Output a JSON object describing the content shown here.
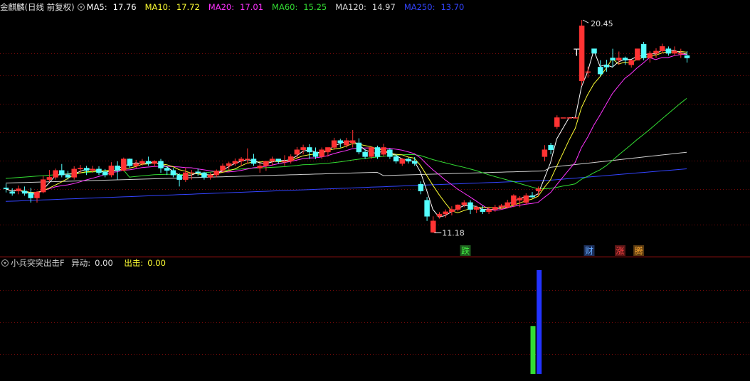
{
  "main_header": {
    "title": "金麒麟(日线 前复权)",
    "ma": [
      {
        "label": "MA5:",
        "value": "17.76",
        "color": "#ffffff"
      },
      {
        "label": "MA10:",
        "value": "17.72",
        "color": "#ffff33"
      },
      {
        "label": "MA20:",
        "value": "17.01",
        "color": "#ff33ff"
      },
      {
        "label": "MA60:",
        "value": "15.25",
        "color": "#33dd33"
      },
      {
        "label": "MA120:",
        "value": "14.97",
        "color": "#d8d8d8"
      },
      {
        "label": "MA250:",
        "value": "13.70",
        "color": "#3344ff"
      }
    ]
  },
  "indicator_header": {
    "name": "小兵突突出击F",
    "fields": [
      {
        "label": "异动:",
        "value": "0.00",
        "color": "#e0e0e0"
      },
      {
        "label": "出击:",
        "value": "0.00",
        "color": "#ffff33"
      }
    ]
  },
  "annotations": {
    "high": "20.45",
    "low": "11.18",
    "t_mark": "T",
    "badges": [
      {
        "text": "跌",
        "bg": "#1d5a1d",
        "fg": "#44ee44"
      },
      {
        "text": "财",
        "bg": "#1c2f5a",
        "fg": "#66aaff"
      },
      {
        "text": "涨",
        "bg": "#5a1616",
        "fg": "#ff4444"
      },
      {
        "text": "腾",
        "bg": "#5a3a10",
        "fg": "#ffaa33"
      }
    ]
  },
  "chart_data": {
    "type": "candlestick",
    "price_range": [
      10.3,
      21.2
    ],
    "up_color": "#ff3333",
    "down_color": "#54ffff",
    "candles": [
      [
        13.14,
        13.32,
        12.94,
        13.1
      ],
      [
        12.97,
        13.12,
        12.8,
        12.9
      ],
      [
        13.0,
        13.24,
        12.86,
        13.1
      ],
      [
        13.0,
        13.2,
        12.8,
        12.9
      ],
      [
        12.92,
        13.14,
        12.5,
        12.7
      ],
      [
        12.7,
        13.0,
        12.5,
        12.96
      ],
      [
        12.96,
        13.66,
        12.9,
        13.5
      ],
      [
        13.5,
        13.92,
        13.4,
        13.6
      ],
      [
        13.6,
        13.98,
        13.5,
        13.9
      ],
      [
        13.9,
        14.18,
        13.6,
        13.7
      ],
      [
        13.7,
        13.88,
        13.5,
        13.6
      ],
      [
        13.6,
        14.08,
        13.5,
        13.96
      ],
      [
        13.96,
        14.14,
        13.76,
        14.0
      ],
      [
        14.0,
        14.1,
        13.7,
        13.9
      ],
      [
        13.9,
        14.1,
        13.8,
        13.96
      ],
      [
        13.96,
        14.08,
        13.7,
        13.8
      ],
      [
        13.84,
        13.96,
        13.6,
        13.7
      ],
      [
        13.7,
        14.26,
        13.6,
        14.1
      ],
      [
        14.1,
        14.3,
        13.5,
        13.9
      ],
      [
        13.9,
        14.46,
        13.86,
        14.4
      ],
      [
        14.4,
        14.42,
        14.0,
        14.1
      ],
      [
        14.1,
        14.36,
        14.0,
        14.2
      ],
      [
        14.2,
        14.4,
        14.1,
        14.3
      ],
      [
        14.3,
        14.5,
        14.1,
        14.2
      ],
      [
        14.2,
        14.34,
        14.06,
        14.3
      ],
      [
        14.3,
        14.4,
        13.8,
        14.0
      ],
      [
        14.0,
        14.08,
        13.7,
        13.9
      ],
      [
        13.9,
        14.0,
        13.6,
        13.7
      ],
      [
        13.7,
        13.78,
        13.2,
        13.5
      ],
      [
        13.5,
        14.02,
        13.4,
        13.8
      ],
      [
        13.8,
        13.92,
        13.5,
        13.8
      ],
      [
        13.84,
        13.98,
        13.66,
        13.8
      ],
      [
        13.8,
        13.84,
        13.5,
        13.6
      ],
      [
        13.6,
        13.8,
        13.5,
        13.7
      ],
      [
        13.7,
        13.94,
        13.6,
        13.88
      ],
      [
        13.9,
        14.2,
        13.82,
        14.1
      ],
      [
        14.1,
        14.28,
        13.9,
        14.2
      ],
      [
        14.2,
        14.42,
        14.1,
        14.3
      ],
      [
        14.3,
        14.48,
        14.1,
        14.4
      ],
      [
        14.4,
        14.86,
        14.2,
        14.4
      ],
      [
        14.4,
        14.62,
        14.1,
        14.2
      ],
      [
        14.0,
        14.22,
        13.8,
        14.1
      ],
      [
        14.1,
        14.32,
        13.88,
        14.3
      ],
      [
        14.3,
        14.5,
        14.1,
        14.4
      ],
      [
        14.4,
        14.4,
        14.2,
        14.3
      ],
      [
        14.3,
        14.56,
        14.1,
        14.3
      ],
      [
        14.3,
        14.6,
        14.2,
        14.5
      ],
      [
        14.6,
        14.92,
        14.4,
        14.8
      ],
      [
        14.8,
        15.02,
        14.6,
        14.9
      ],
      [
        14.9,
        15.04,
        14.4,
        14.7
      ],
      [
        14.7,
        14.9,
        14.4,
        14.5
      ],
      [
        14.5,
        14.9,
        14.4,
        14.8
      ],
      [
        14.7,
        14.9,
        14.5,
        14.9
      ],
      [
        14.9,
        15.32,
        14.8,
        15.2
      ],
      [
        15.2,
        15.28,
        14.9,
        15.1
      ],
      [
        15.0,
        15.32,
        14.9,
        15.2
      ],
      [
        15.1,
        15.66,
        14.9,
        15.2
      ],
      [
        15.1,
        15.3,
        14.6,
        14.7
      ],
      [
        14.7,
        14.82,
        14.4,
        14.5
      ],
      [
        14.5,
        14.94,
        14.4,
        14.9
      ],
      [
        14.9,
        14.98,
        14.4,
        14.5
      ],
      [
        14.6,
        15.06,
        14.5,
        14.9
      ],
      [
        14.8,
        14.86,
        14.4,
        14.5
      ],
      [
        14.5,
        14.62,
        14.2,
        14.3
      ],
      [
        14.2,
        14.44,
        14.1,
        14.4
      ],
      [
        14.4,
        14.46,
        14.2,
        14.3
      ],
      [
        14.3,
        14.48,
        14.1,
        14.2
      ],
      [
        13.3,
        13.42,
        12.86,
        13.0
      ],
      [
        12.6,
        12.74,
        11.7,
        11.9
      ],
      [
        11.2,
        11.9,
        11.18,
        11.7
      ],
      [
        11.9,
        12.08,
        11.8,
        12.0
      ],
      [
        12.0,
        12.2,
        11.84,
        12.1
      ],
      [
        12.1,
        12.34,
        11.94,
        12.2
      ],
      [
        12.2,
        12.42,
        12.12,
        12.4
      ],
      [
        12.4,
        12.6,
        12.3,
        12.5
      ],
      [
        12.5,
        12.6,
        12.0,
        12.2
      ],
      [
        12.2,
        12.36,
        12.04,
        12.3
      ],
      [
        12.2,
        12.36,
        12.0,
        12.1
      ],
      [
        12.1,
        12.32,
        12.0,
        12.2
      ],
      [
        12.2,
        12.4,
        12.1,
        12.3
      ],
      [
        12.3,
        12.44,
        12.2,
        12.36
      ],
      [
        12.3,
        12.62,
        12.24,
        12.5
      ],
      [
        12.4,
        12.86,
        12.3,
        12.8
      ],
      [
        12.6,
        12.78,
        12.3,
        12.7
      ],
      [
        12.5,
        12.9,
        12.4,
        12.8
      ],
      [
        12.8,
        12.96,
        12.7,
        12.74
      ],
      [
        13.0,
        13.2,
        12.8,
        13.1
      ],
      [
        14.5,
        15.0,
        14.3,
        14.8
      ],
      [
        15.0,
        15.1,
        14.6,
        14.8
      ],
      [
        15.8,
        16.3,
        15.7,
        16.2
      ],
      [
        16.2,
        16.2,
        16.2,
        16.2
      ],
      [
        16.2,
        16.2,
        16.2,
        16.2
      ],
      [
        16.2,
        16.2,
        16.2,
        16.2
      ],
      [
        17.8,
        20.45,
        17.6,
        20.2
      ],
      [
        18.2,
        18.42,
        17.94,
        18.2
      ],
      [
        19.2,
        19.2,
        19.0,
        19.0
      ],
      [
        18.4,
        18.7,
        18.0,
        18.1
      ],
      [
        18.5,
        18.72,
        18.2,
        18.4
      ],
      [
        18.8,
        19.2,
        18.4,
        18.7
      ],
      [
        18.7,
        19.08,
        18.5,
        18.8
      ],
      [
        18.8,
        18.86,
        18.5,
        18.7
      ],
      [
        18.5,
        18.72,
        18.38,
        18.7
      ],
      [
        18.7,
        19.2,
        18.7,
        19.2
      ],
      [
        19.4,
        19.5,
        18.7,
        18.8
      ],
      [
        18.8,
        19.1,
        18.6,
        19.0
      ],
      [
        19.0,
        19.22,
        18.8,
        19.1
      ],
      [
        19.1,
        19.42,
        19.0,
        19.3
      ],
      [
        19.2,
        19.3,
        18.9,
        19.0
      ],
      [
        19.0,
        19.3,
        18.9,
        19.1
      ],
      [
        19.0,
        19.2,
        18.8,
        19.0
      ],
      [
        18.9,
        19.1,
        18.6,
        18.8
      ]
    ],
    "indicator": {
      "ylim": [
        0,
        1.2
      ],
      "bars": [
        {
          "index": 85,
          "value": 0.46,
          "color": "#33dd33"
        },
        {
          "index": 86,
          "value": 1.0,
          "color": "#2233ff"
        }
      ]
    }
  }
}
